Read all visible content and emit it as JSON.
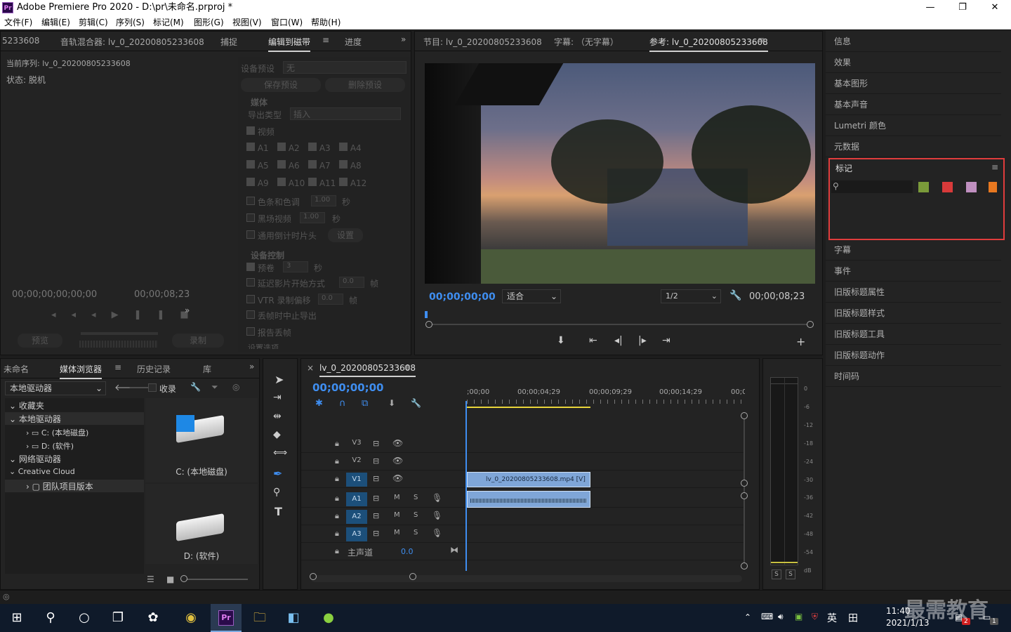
{
  "window": {
    "title": "Adobe Premiere Pro 2020 - D:\\pr\\未命名.prproj *",
    "app_icon_text": "Pr",
    "minimize": "—",
    "maximize": "❐",
    "close": "✕"
  },
  "menu": [
    "文件(F)",
    "编辑(E)",
    "剪辑(C)",
    "序列(S)",
    "标记(M)",
    "图形(G)",
    "视图(V)",
    "窗口(W)",
    "帮助(H)"
  ],
  "source_panel": {
    "tabs": [
      "5233608",
      "音轨混合器: lv_0_20200805233608",
      "捕捉",
      "编辑到磁带",
      "进度"
    ],
    "active_tab": "编辑到磁带",
    "current_sequence": "当前序列: lv_0_20200805233608",
    "status": "状态: 脱机",
    "tc_left": "00;00;00;00;00;00",
    "tc_right": "00;00;08;23",
    "preview_btn": "预览",
    "record_btn": "录制"
  },
  "export_settings": {
    "device_preset_label": "设备预设",
    "device_preset_value": "无",
    "save_preset": "保存预设",
    "delete_preset": "删除预设",
    "media_heading": "媒体",
    "export_type_label": "导出类型",
    "export_type_value": "插入",
    "video_label": "视频",
    "audio_tracks": [
      "A1",
      "A2",
      "A3",
      "A4",
      "A5",
      "A6",
      "A7",
      "A8",
      "A9",
      "A10",
      "A11",
      "A12"
    ],
    "color_bars": "色条和色调",
    "color_bars_val": "1.00",
    "color_bars_unit": "秒",
    "black_video": "黑场视频",
    "black_video_val": "1.00",
    "black_video_unit": "秒",
    "countdown": "通用倒计时片头",
    "countdown_btn": "设置",
    "device_control_heading": "设备控制",
    "preroll": "预卷",
    "preroll_val": "3",
    "preroll_unit": "秒",
    "delay_movie": "延迟影片开始方式",
    "delay_movie_val": "0.0",
    "delay_movie_unit": "帧",
    "vtr_offset": "VTR 录制偏移",
    "vtr_offset_val": "0.0",
    "vtr_offset_unit": "帧",
    "abort_drop": "丢帧时中止导出",
    "report_drop": "报告丢帧",
    "more": "设置选项"
  },
  "program_monitor": {
    "tabs": [
      "节目: lv_0_20200805233608",
      "字幕: （无字幕）",
      "参考: lv_0_20200805233608"
    ],
    "active_tab": "参考: lv_0_20200805233608",
    "timecode": "00;00;00;00",
    "fit": "适合",
    "resolution": "1/2",
    "duration": "00;00;08;23"
  },
  "right_panels": {
    "items_top": [
      "信息",
      "效果",
      "基本图形",
      "基本声音",
      "Lumetri 颜色",
      "元数据"
    ],
    "markers_title": "标记",
    "marker_colors": [
      "#7a9a3a",
      "#d83a3a",
      "#c090c0",
      "#e87820"
    ],
    "items_bottom": [
      "字幕",
      "事件",
      "旧版标题属性",
      "旧版标题样式",
      "旧版标题工具",
      "旧版标题动作",
      "时间码"
    ]
  },
  "media_browser": {
    "tabs": [
      "未命名",
      "媒体浏览器",
      "历史记录",
      "库"
    ],
    "active_tab": "媒体浏览器",
    "drive_select": "本地驱动器",
    "ingest": "收录",
    "tree": [
      {
        "label": "收藏夹",
        "level": 0
      },
      {
        "label": "本地驱动器",
        "level": 0
      },
      {
        "label": "C: (本地磁盘)",
        "level": 1
      },
      {
        "label": "D: (软件)",
        "level": 1
      },
      {
        "label": "网络驱动器",
        "level": 0
      },
      {
        "label": "Creative Cloud",
        "level": 0
      },
      {
        "label": "团队项目版本",
        "level": 1
      }
    ],
    "drives": [
      "C: (本地磁盘)",
      "D: (软件)"
    ]
  },
  "timeline": {
    "sequence_name": "lv_0_20200805233608",
    "timecode": "00;00;00;00",
    "ruler_labels": [
      ";00;00",
      "00;00;04;29",
      "00;00;09;29",
      "00;00;14;29",
      "00;0"
    ],
    "video_tracks": [
      "V3",
      "V2",
      "V1"
    ],
    "audio_tracks": [
      "A1",
      "A2",
      "A3"
    ],
    "master_label": "主声道",
    "master_value": "0.0",
    "video_clip": "lv_0_20200805233608.mp4 [V]",
    "mute": "M",
    "solo": "S"
  },
  "audio_meter": {
    "scale": [
      "0",
      "-6",
      "-12",
      "-18",
      "-24",
      "-30",
      "-36",
      "-42",
      "-48",
      "-54",
      "dB"
    ],
    "solo_left": "S",
    "solo_right": "S"
  },
  "taskbar": {
    "ime": "英",
    "time": "11:40",
    "date": "2021/1/13",
    "watermark": "最需教育",
    "notify_badge": "2",
    "action_badge": "1"
  }
}
